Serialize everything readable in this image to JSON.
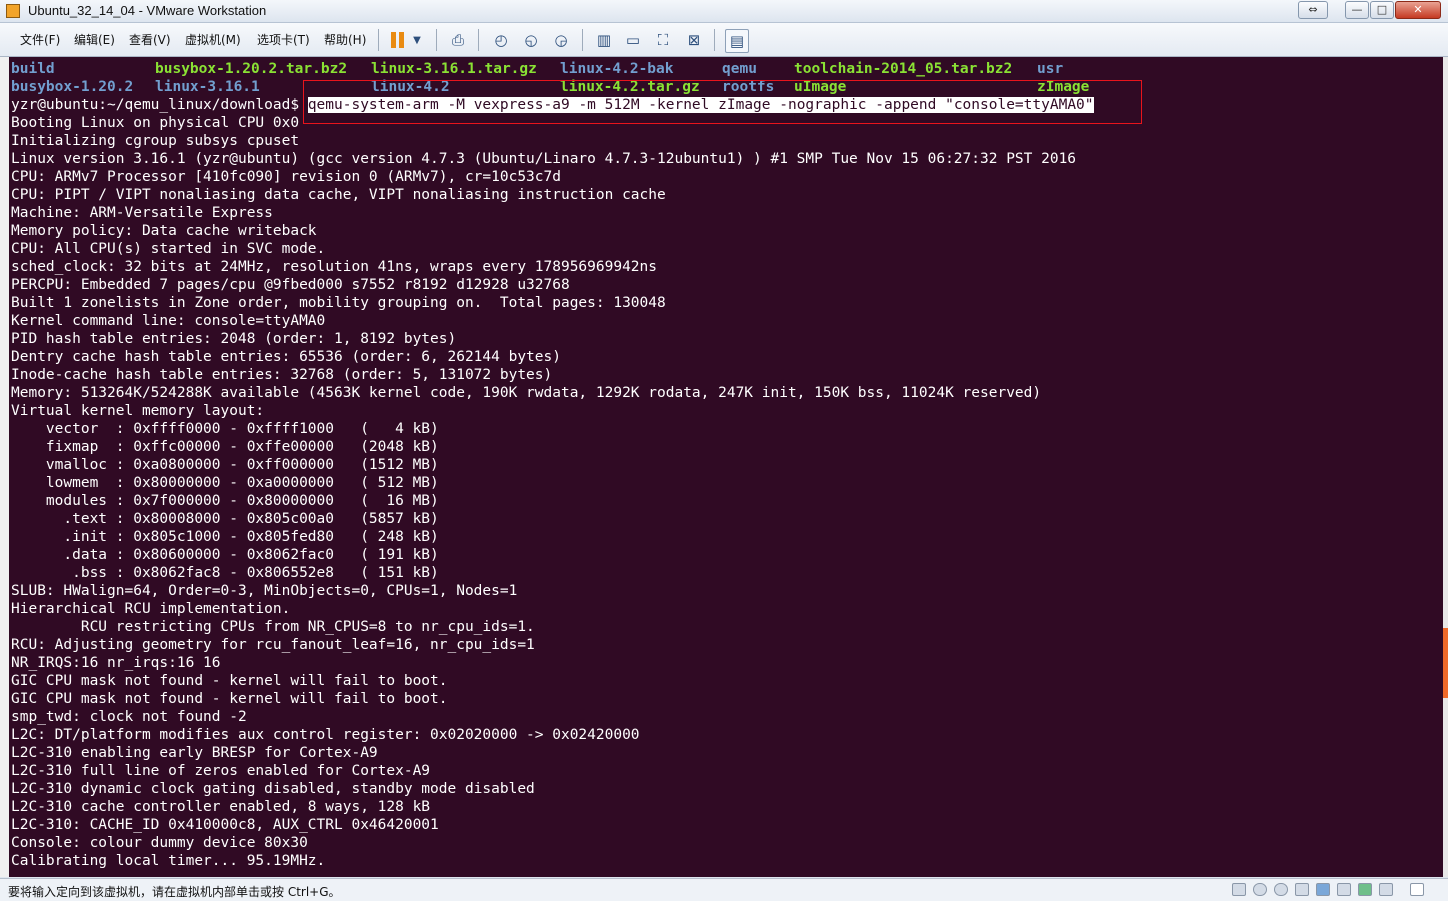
{
  "window": {
    "title": "Ubuntu_32_14_04 - VMware Workstation",
    "controls": {
      "restore_glyph": "⇔",
      "minimize_glyph": "—",
      "maximize_glyph": "□",
      "close_glyph": "✕"
    }
  },
  "menubar": {
    "items": [
      "文件(F)",
      "编辑(E)",
      "查看(V)",
      "虚拟机(M)",
      "选项卡(T)",
      "帮助(H)"
    ]
  },
  "toolbar": {
    "icons": [
      "pause-icon",
      "dropdown-icon",
      "send-ctrl-alt-del-icon",
      "snapshot-icon",
      "revert-snapshot-icon",
      "snapshot-manager-icon",
      "sidebar-view-icon",
      "console-view-icon",
      "fullscreen-icon",
      "unity-icon",
      "thumbnail-icon"
    ]
  },
  "terminal": {
    "ls_row1": [
      "build",
      "busybox-1.20.2.tar.bz2",
      "linux-3.16.1.tar.gz",
      "linux-4.2-bak",
      "qemu",
      "toolchain-2014_05.tar.bz2",
      "usr"
    ],
    "ls_row2": [
      "busybox-1.20.2",
      "linux-3.16.1",
      "linux-4.2",
      "linux-4.2.tar.gz",
      "rootfs",
      "uImage",
      "zImage"
    ],
    "prompt": "yzr@ubuntu:~/qemu_linux/download$",
    "command": "qemu-system-arm -M vexpress-a9 -m 512M -kernel zImage -nographic -append \"console=ttyAMA0\"",
    "lines": [
      "Booting Linux on physical CPU 0x0",
      "Initializing cgroup subsys cpuset",
      "Linux version 3.16.1 (yzr@ubuntu) (gcc version 4.7.3 (Ubuntu/Linaro 4.7.3-12ubuntu1) ) #1 SMP Tue Nov 15 06:27:32 PST 2016",
      "CPU: ARMv7 Processor [410fc090] revision 0 (ARMv7), cr=10c53c7d",
      "CPU: PIPT / VIPT nonaliasing data cache, VIPT nonaliasing instruction cache",
      "Machine: ARM-Versatile Express",
      "Memory policy: Data cache writeback",
      "CPU: All CPU(s) started in SVC mode.",
      "sched_clock: 32 bits at 24MHz, resolution 41ns, wraps every 178956969942ns",
      "PERCPU: Embedded 7 pages/cpu @9fbed000 s7552 r8192 d12928 u32768",
      "Built 1 zonelists in Zone order, mobility grouping on.  Total pages: 130048",
      "Kernel command line: console=ttyAMA0",
      "PID hash table entries: 2048 (order: 1, 8192 bytes)",
      "Dentry cache hash table entries: 65536 (order: 6, 262144 bytes)",
      "Inode-cache hash table entries: 32768 (order: 5, 131072 bytes)",
      "Memory: 513264K/524288K available (4563K kernel code, 190K rwdata, 1292K rodata, 247K init, 150K bss, 11024K reserved)",
      "Virtual kernel memory layout:",
      "    vector  : 0xffff0000 - 0xffff1000   (   4 kB)",
      "    fixmap  : 0xffc00000 - 0xffe00000   (2048 kB)",
      "    vmalloc : 0xa0800000 - 0xff000000   (1512 MB)",
      "    lowmem  : 0x80000000 - 0xa0000000   ( 512 MB)",
      "    modules : 0x7f000000 - 0x80000000   (  16 MB)",
      "      .text : 0x80008000 - 0x805c00a0   (5857 kB)",
      "      .init : 0x805c1000 - 0x805fed80   ( 248 kB)",
      "      .data : 0x80600000 - 0x8062fac0   ( 191 kB)",
      "       .bss : 0x8062fac8 - 0x806552e8   ( 151 kB)",
      "SLUB: HWalign=64, Order=0-3, MinObjects=0, CPUs=1, Nodes=1",
      "Hierarchical RCU implementation.",
      "        RCU restricting CPUs from NR_CPUS=8 to nr_cpu_ids=1.",
      "RCU: Adjusting geometry for rcu_fanout_leaf=16, nr_cpu_ids=1",
      "NR_IRQS:16 nr_irqs:16 16",
      "GIC CPU mask not found - kernel will fail to boot.",
      "GIC CPU mask not found - kernel will fail to boot.",
      "smp_twd: clock not found -2",
      "L2C: DT/platform modifies aux control register: 0x02020000 -> 0x02420000",
      "L2C-310 enabling early BRESP for Cortex-A9",
      "L2C-310 full line of zeros enabled for Cortex-A9",
      "L2C-310 dynamic clock gating disabled, standby mode disabled",
      "L2C-310 cache controller enabled, 8 ways, 128 kB",
      "L2C-310: CACHE_ID 0x410000c8, AUX_CTRL 0x46420001",
      "Console: colour dummy device 80x30",
      "Calibrating local timer... 95.19MHz."
    ]
  },
  "statusbar": {
    "message": "要将输入定向到该虚拟机，请在虚拟机内部单击或按 Ctrl+G。",
    "device_icons": [
      "hard-disk-icon",
      "cd-dvd-icon",
      "cd-dvd-2-icon",
      "floppy-icon",
      "network-adapter-icon",
      "printer-icon",
      "sound-card-icon",
      "display-icon",
      "message-log-icon"
    ]
  },
  "colors": {
    "terminal_bg": "#300a24",
    "terminal_fg": "#ffffff",
    "ls_directory": "#729fcf",
    "ls_archive": "#8ae234",
    "highlight_box": "#e8141c"
  }
}
